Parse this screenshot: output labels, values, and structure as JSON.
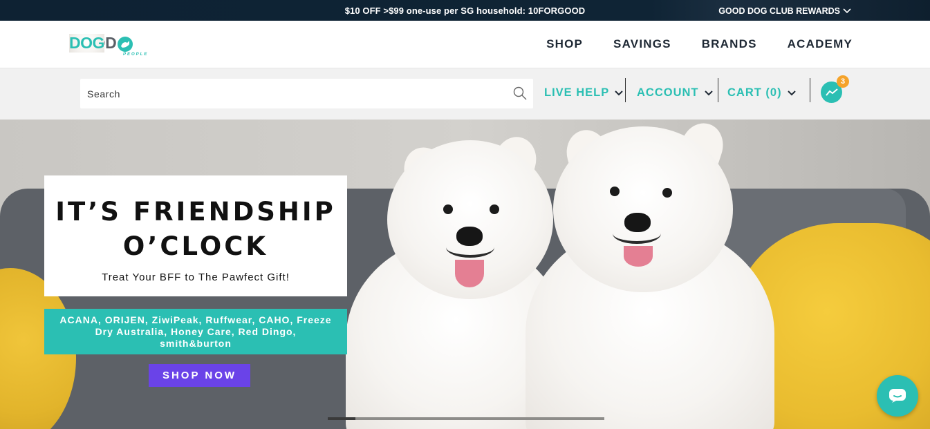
{
  "topbar": {
    "promo": "$10 OFF >$99 one-use per SG household: 10FORGOOD",
    "rewards": "GOOD DOG CLUB REWARDS",
    "rewards_icon": "chevron-down-icon"
  },
  "logo": {
    "good": "GOOD",
    "dog": "DOG",
    "people": "PEOPLE"
  },
  "nav": {
    "items": [
      {
        "label": "SHOP"
      },
      {
        "label": "SAVINGS"
      },
      {
        "label": "BRANDS"
      },
      {
        "label": "ACADEMY"
      }
    ]
  },
  "utility": {
    "search_placeholder": "Search",
    "live_help": "LIVE HELP",
    "account": "ACCOUNT",
    "cart": "CART (0)",
    "messenger_badge": "3"
  },
  "hero": {
    "headline_line1": "IT’S FRIENDSHIP",
    "headline_line2": "O’CLOCK",
    "subheadline": "Treat Your BFF to The Pawfect Gift!",
    "brands": "ACANA, ORIJEN, ZiwiPeak, Ruffwear, CAHO, Freeze Dry Australia, Honey Care, Red Dingo, smith&burton",
    "cta": "SHOP NOW",
    "slide_progress": 0.1
  },
  "colors": {
    "accent": "#2bbfb3",
    "topbar_bg": "#0e2233",
    "cta_bg": "#6a43e8",
    "badge": "#f5a32a"
  }
}
